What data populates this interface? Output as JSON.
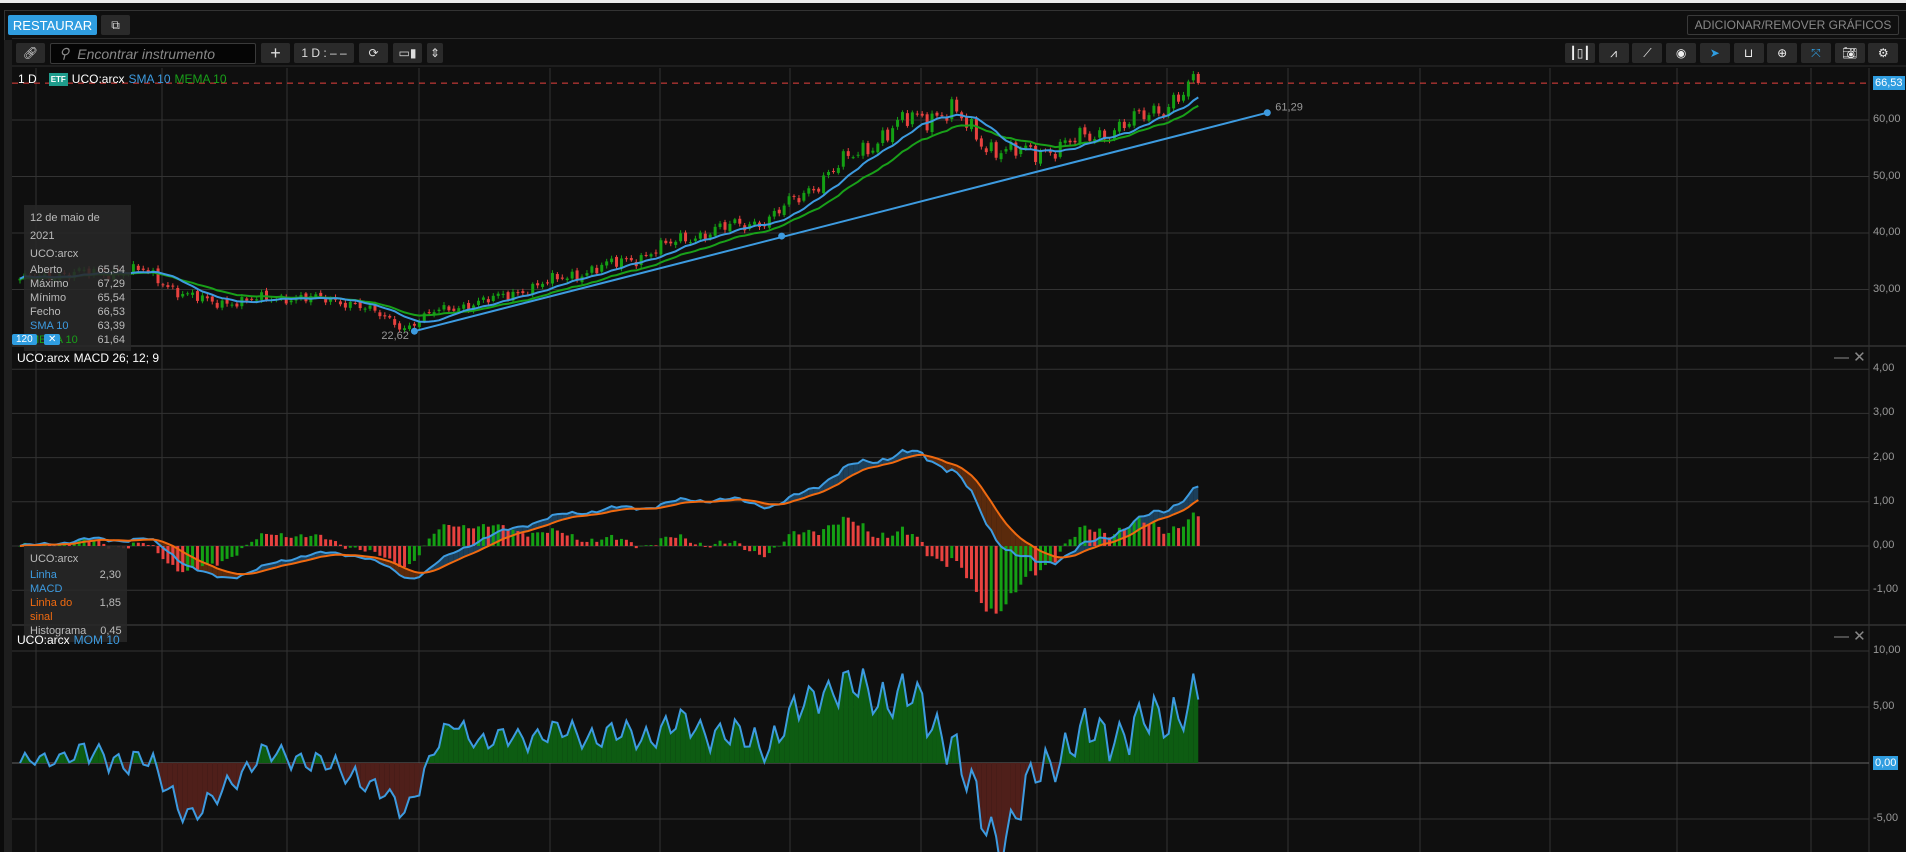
{
  "header": {
    "restore_label": "RESTAURAR",
    "add_remove_label": "ADICIONAR/REMOVER GRÁFICOS"
  },
  "toolbar": {
    "search_placeholder": "Encontrar instrumento",
    "interval_label": "1 D : – –",
    "right_icons": [
      "candles-icon",
      "indicators-icon",
      "draw-line-icon",
      "eye-icon",
      "cursor-icon",
      "curve-icon",
      "zoom-icon",
      "collapse-icon",
      "camera-icon",
      "gear-icon"
    ]
  },
  "main_pane": {
    "interval": "1 D",
    "badge": "ETF",
    "symbol": "UCO:arcx",
    "sma_label": "SMA 10",
    "mema_label": "MEMA 10",
    "last_price": "66,53",
    "trend_start_label": "22,62",
    "trend_end_label": "61,29",
    "axis": [
      "60,00",
      "50,00",
      "40,00",
      "30,00"
    ],
    "tag_120": "120",
    "tag_x": "✕"
  },
  "tooltip": {
    "date": "12 de maio de 2021",
    "symbol": "UCO:arcx",
    "rows": [
      {
        "k": "Aberto",
        "v": "65,54"
      },
      {
        "k": "Máximo",
        "v": "67,29"
      },
      {
        "k": "Mínimo",
        "v": "65,54"
      },
      {
        "k": "Fecho",
        "v": "66,53"
      },
      {
        "k": "SMA 10",
        "v": "63,39"
      },
      {
        "k": "MEMA 10",
        "v": "61,64"
      }
    ]
  },
  "macd_pane": {
    "symbol": "UCO:arcx",
    "title": "MACD 26; 12; 9",
    "axis": [
      "4,00",
      "3,00",
      "2,00",
      "1,00",
      "0,00",
      "-1,00"
    ],
    "tooltip": {
      "symbol": "UCO:arcx",
      "rows": [
        {
          "k": "Linha MACD",
          "v": "2,30"
        },
        {
          "k": "Linha do sinal",
          "v": "1,85"
        },
        {
          "k": "Histograma",
          "v": "0,45"
        }
      ]
    }
  },
  "mom_pane": {
    "symbol": "UCO:arcx",
    "title": "MOM 10",
    "axis": [
      "10,00",
      "5,00",
      "-5,00"
    ],
    "zero_tag": "0,00"
  },
  "colors": {
    "accent": "#2f9de0",
    "up": "#14a014",
    "down": "#e8423f",
    "sma": "#3d9be0",
    "mema": "#19a019",
    "signal": "#f06a10"
  },
  "chart_data": {
    "type": "candlestick",
    "bars": 240,
    "close_anchors": [
      [
        0,
        31.5
      ],
      [
        6,
        32.6
      ],
      [
        25,
        33.3
      ],
      [
        33,
        29.3
      ],
      [
        39,
        27.6
      ],
      [
        56,
        28.7
      ],
      [
        68,
        27.6
      ],
      [
        78,
        23.2
      ],
      [
        84,
        26
      ],
      [
        96,
        28.3
      ],
      [
        110,
        32
      ],
      [
        126,
        35.9
      ],
      [
        135,
        39.1
      ],
      [
        145,
        41.3
      ],
      [
        152,
        42.4
      ],
      [
        160,
        47.8
      ],
      [
        170,
        54.3
      ],
      [
        181,
        60.5
      ],
      [
        189,
        61.5
      ],
      [
        196,
        55.5
      ],
      [
        201,
        54.3
      ],
      [
        206,
        54.3
      ],
      [
        211,
        55.4
      ],
      [
        219,
        57.5
      ],
      [
        226,
        59.7
      ],
      [
        232,
        62.5
      ],
      [
        239,
        66.53
      ]
    ],
    "trendline": {
      "from": [
        80,
        22.62
      ],
      "to": [
        253,
        61.29
      ]
    },
    "price_ylim": [
      20,
      69
    ],
    "macd_ylim": [
      -1.7,
      4.5
    ],
    "mom_ylim": [
      -8.2,
      12.5
    ]
  }
}
